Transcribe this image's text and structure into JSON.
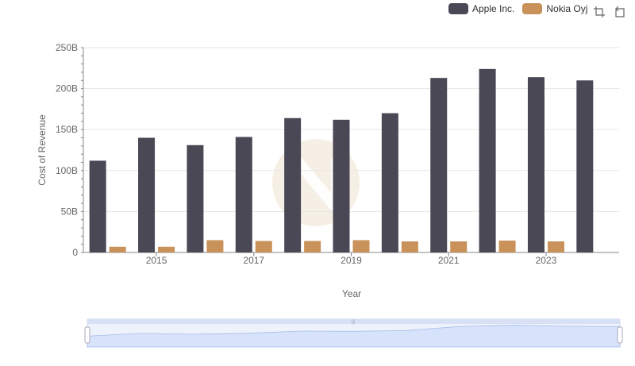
{
  "chart_data": {
    "type": "bar",
    "xlabel": "Year",
    "ylabel": "Cost of Revenue",
    "ylim": [
      0,
      250000000000
    ],
    "y_ticks": [
      "0",
      "50B",
      "100B",
      "150B",
      "200B",
      "250B"
    ],
    "x": [
      2014,
      2015,
      2016,
      2017,
      2018,
      2019,
      2020,
      2021,
      2022,
      2023,
      2024
    ],
    "x_tick_labels": [
      "2015",
      "2017",
      "2019",
      "2021",
      "2023"
    ],
    "series": [
      {
        "name": "Apple Inc.",
        "color": "#4a4855",
        "values": [
          112000000000,
          140000000000,
          131000000000,
          141000000000,
          164000000000,
          162000000000,
          170000000000,
          213000000000,
          224000000000,
          214000000000,
          210000000000
        ]
      },
      {
        "name": "Nokia Oyj",
        "color": "#c8925a",
        "values": [
          7000000000,
          7000000000,
          15000000000,
          14000000000,
          14000000000,
          15000000000,
          13500000000,
          13500000000,
          14500000000,
          13500000000,
          null
        ]
      }
    ],
    "legend_position": "top-right",
    "grid": true,
    "data_zoom": true
  },
  "legend": {
    "items": [
      {
        "label": "Apple Inc.",
        "color": "#4a4855"
      },
      {
        "label": "Nokia Oyj",
        "color": "#c8925a"
      }
    ]
  },
  "toolbox": {
    "icons": [
      "zoom-icon",
      "restore-icon"
    ]
  }
}
